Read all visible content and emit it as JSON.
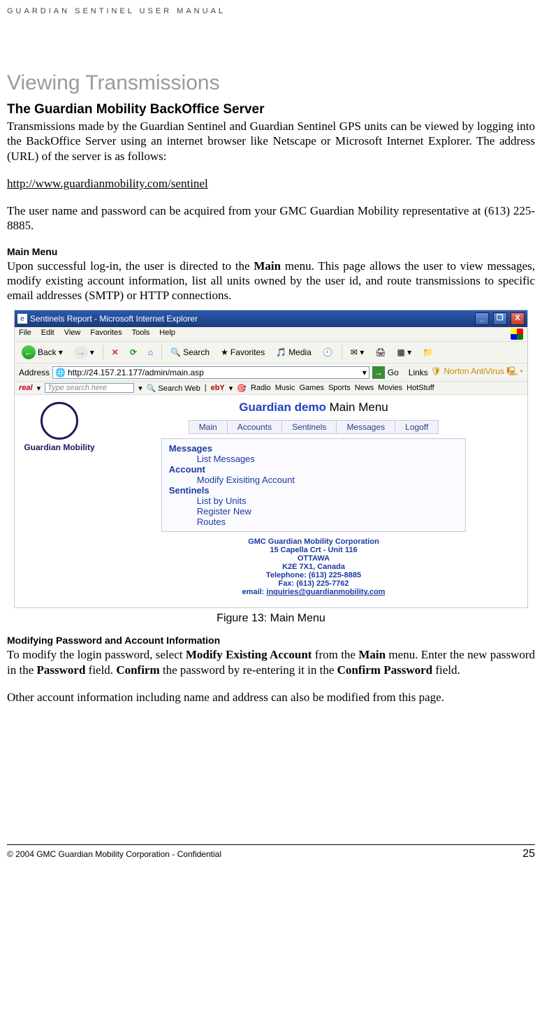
{
  "header": {
    "running": "GUARDIAN SENTINEL USER MANUAL"
  },
  "title": "Viewing Transmissions",
  "section1": {
    "heading": "The Guardian Mobility BackOffice Server",
    "para1": "Transmissions made by the Guardian Sentinel and Guardian Sentinel GPS units can be viewed by logging into the BackOffice Server using an internet browser like Netscape or Microsoft Internet Explorer. The address (URL) of the server is as follows:",
    "url": "http://www.guardianmobility.com/sentinel",
    "para2": "The user name and password can be acquired from your GMC Guardian Mobility representative at (613) 225-8885."
  },
  "section2": {
    "heading": "Main Menu",
    "para_pre": "Upon successful log-in, the user is directed to the ",
    "bold1": "Main",
    "para_post": " menu. This page allows the user to view messages, modify existing account information, list all units owned by the user id, and route transmissions to specific email addresses (SMTP) or HTTP connections."
  },
  "screenshot": {
    "window_title": "Sentinels Report - Microsoft Internet Explorer",
    "menus": [
      "File",
      "Edit",
      "View",
      "Favorites",
      "Tools",
      "Help"
    ],
    "toolbar": {
      "back": "Back",
      "search": "Search",
      "favorites": "Favorites",
      "media": "Media"
    },
    "address_label": "Address",
    "address_value": "http://24.157.21.177/admin/main.asp",
    "go_label": "Go",
    "links_label": "Links",
    "norton": "Norton AntiVirus",
    "real": {
      "brand": "real",
      "placeholder": "Type search here",
      "searchweb": "Search Web",
      "links": [
        "ebY",
        "Radio",
        "Music",
        "Games",
        "Sports",
        "News",
        "Movies",
        "HotStuff"
      ]
    },
    "logo_text": "Guardian Mobility",
    "page_title_demo": "Guardian demo",
    "page_title_rest": " Main Menu",
    "tabs": [
      "Main",
      "Accounts",
      "Sentinels",
      "Messages",
      "Logoff"
    ],
    "menu": {
      "cat1": "Messages",
      "item1": "List Messages",
      "cat2": "Account",
      "item2": "Modify Exisiting Account",
      "cat3": "Sentinels",
      "item3a": "List by Units",
      "item3b": "Register New",
      "item3c": "Routes"
    },
    "footer": {
      "l1": "GMC Guardian Mobility Corporation",
      "l2": "15 Capella Crt - Unit 116",
      "l3": "OTTAWA",
      "l4": "K2E 7X1, Canada",
      "l5": "Telephone: (613) 225-8885",
      "l6": "Fax:  (613) 225-7762",
      "l7pre": "email: ",
      "l7link": "inquiries@guardianmobility.com"
    }
  },
  "figcaption": "Figure 13: Main Menu",
  "section3": {
    "heading": "Modifying Password and Account Information",
    "p1_a": "To modify the login password, select ",
    "p1_b": "Modify Existing Account",
    "p1_c": " from the ",
    "p1_d": "Main",
    "p1_e": " menu. Enter the new password in the ",
    "p1_f": "Password",
    "p1_g": " field. ",
    "p1_h": "Confirm",
    "p1_i": " the password by re-entering it in the ",
    "p1_j": "Confirm Password",
    "p1_k": " field.",
    "p2": "Other account information including name and address can also be modified from this page."
  },
  "footer": {
    "copyright": "© 2004 GMC Guardian Mobility Corporation - Confidential",
    "page": "25"
  }
}
